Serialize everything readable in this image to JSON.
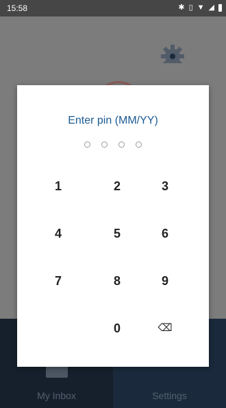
{
  "status_bar": {
    "time": "15:58",
    "icons": [
      "bluetooth-icon",
      "vibrate-icon",
      "wifi-icon",
      "signal-icon",
      "battery-icon"
    ]
  },
  "bottom_nav": {
    "tabs": [
      {
        "label": "My Inbox",
        "icon": "inbox-icon",
        "active": true
      },
      {
        "label": "Settings",
        "icon": "gear-icon",
        "active": false
      }
    ]
  },
  "dialog": {
    "title": "Enter pin (MM/YY)",
    "pin_length": 4,
    "pin_filled": 0,
    "keys": [
      "1",
      "2",
      "3",
      "4",
      "5",
      "6",
      "7",
      "8",
      "9",
      "",
      "0",
      "⌫"
    ],
    "colors": {
      "title": "#1b5a92",
      "key_text": "#222222"
    }
  }
}
